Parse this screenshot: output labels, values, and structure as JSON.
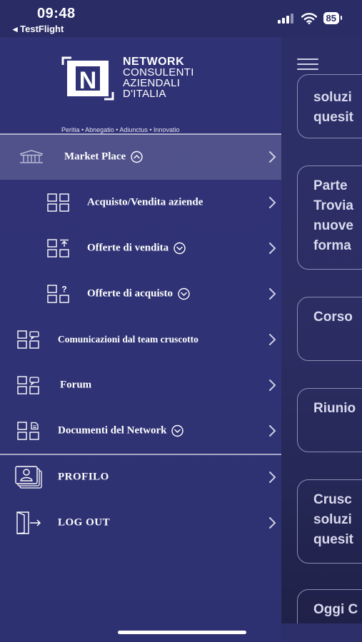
{
  "status_bar": {
    "time": "09:48",
    "back_label": "TestFlight",
    "battery": "85"
  },
  "logo": {
    "letter": "N",
    "line1": "NETWORK",
    "line2": "CONSULENTI",
    "line3": "AZIENDALI",
    "line4": "D'ITALIA",
    "tagline": "Peritia • Abnegatio • Adiunctus • Innovatio"
  },
  "menu": {
    "market_place": "Market Place",
    "acquisto_vendita": "Acquisto/Vendita aziende",
    "offerte_vendita": "Offerte di vendita",
    "offerte_acquisto": "Offerte di acquisto",
    "comunicazioni": "Comunicazioni dal team cruscotto",
    "forum": "Forum",
    "documenti": "Documenti del Network",
    "profilo": "PROFILO",
    "logout": "LOG OUT"
  },
  "background_cards": [
    {
      "lines": [
        "soluzi",
        "quesit"
      ]
    },
    {
      "lines": [
        "Parte",
        "Trovia",
        "nuove",
        "forma"
      ]
    },
    {
      "lines": [
        "Corso"
      ]
    },
    {
      "lines": [
        "Riunio"
      ]
    },
    {
      "lines": [
        "Crusc",
        "soluzi",
        "quesit"
      ]
    },
    {
      "lines": [
        "Oggi C"
      ]
    }
  ],
  "colors": {
    "drawer_bg": "#303276",
    "active_row": "#4e5090",
    "text": "#ffffff"
  }
}
